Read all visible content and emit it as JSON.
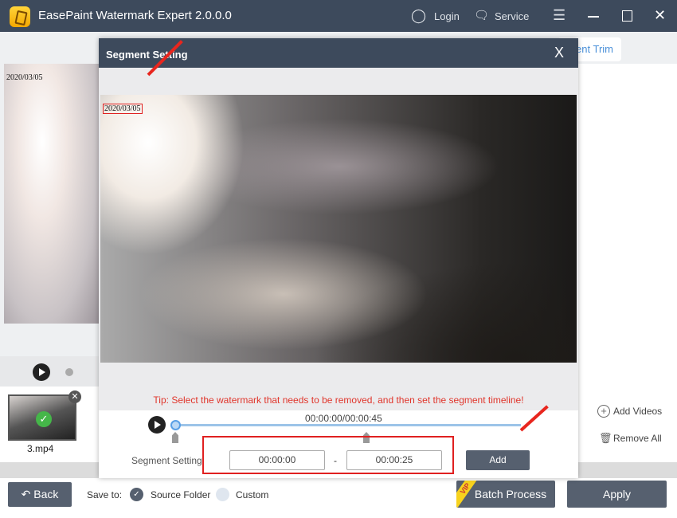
{
  "app": {
    "title": "EasePaint Watermark Expert  2.0.0.0",
    "login": "Login",
    "service": "Service"
  },
  "background": {
    "date_overlay": "2020/03/05",
    "trim_button": "ent Trim",
    "thumbnail_name": "3.mp4",
    "add_videos": "Add Videos",
    "remove_all": "Remove All"
  },
  "bottom": {
    "back": "Back",
    "save_to": "Save to:",
    "source_folder": "Source Folder",
    "custom": "Custom",
    "save_selected": "Source Folder",
    "vip_badge": "VIP",
    "batch_process": "Batch Process",
    "apply": "Apply"
  },
  "dialog": {
    "title": "Segment Setting",
    "close": "X",
    "date_watermark": "2020/03/05",
    "tip": "Tip: Select the watermark that needs to be removed, and then set the segment timeline!",
    "time_readout": "00:00:00/00:00:45",
    "progress_fraction": 0,
    "segment_label": "Segment Setting:",
    "start_time": "00:00:00",
    "separator": "-",
    "end_time": "00:00:25",
    "add": "Add"
  },
  "colors": {
    "titlebar": "#3d4a5c",
    "button": "#56606f",
    "tip": "#e0352b",
    "highlight": "#e02020",
    "accent": "#4a90d9"
  }
}
